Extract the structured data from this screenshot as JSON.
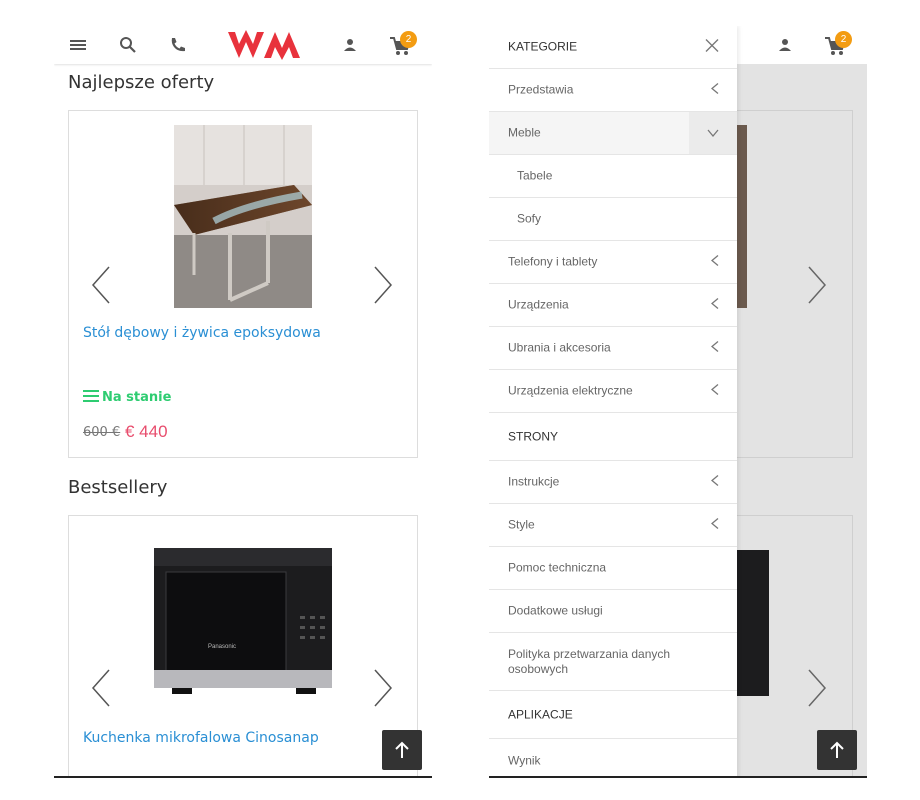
{
  "left": {
    "header": {
      "logo_text": "WM",
      "cart_count": "2"
    },
    "sections": [
      {
        "title": "Najlepsze oferty",
        "product": {
          "name": "Stół dębowy i żywica epoksydowa",
          "stock": "Na stanie",
          "price_old": "600 €",
          "price_new": "€ 440"
        }
      },
      {
        "title": "Bestsellery",
        "product": {
          "name": "Kuchenka mikrofalowa Cinosanap"
        }
      }
    ],
    "microwave_brand": "Panasonic"
  },
  "right": {
    "header": {
      "cart_count": "2"
    },
    "drawer": {
      "rows": [
        {
          "label": "KATEGORIE",
          "kind": "head",
          "icon": "close-icon"
        },
        {
          "label": "Przedstawia",
          "kind": "item",
          "icon": "chevron-left-icon"
        },
        {
          "label": "Meble",
          "kind": "active",
          "icon": "chevron-down-icon"
        },
        {
          "label": "Tabele",
          "kind": "sub"
        },
        {
          "label": "Sofy",
          "kind": "sub"
        },
        {
          "label": "Telefony i tablety",
          "kind": "item",
          "icon": "chevron-left-icon"
        },
        {
          "label": "Urządzenia",
          "kind": "item",
          "icon": "chevron-left-icon"
        },
        {
          "label": "Ubrania i akcesoria",
          "kind": "item",
          "icon": "chevron-left-icon"
        },
        {
          "label": "Urządzenia elektryczne",
          "kind": "item",
          "icon": "chevron-left-icon"
        },
        {
          "label": "STRONY",
          "kind": "head"
        },
        {
          "label": "Instrukcje",
          "kind": "item",
          "icon": "chevron-left-icon"
        },
        {
          "label": "Style",
          "kind": "item",
          "icon": "chevron-left-icon"
        },
        {
          "label": "Pomoc techniczna",
          "kind": "item"
        },
        {
          "label": "Dodatkowe usługi",
          "kind": "item"
        },
        {
          "label": "Polityka przetwarzania danych osobowych",
          "kind": "item"
        },
        {
          "label": "APLIKACJE",
          "kind": "head"
        },
        {
          "label": "Wynik",
          "kind": "item"
        }
      ]
    }
  },
  "colors": {
    "accent_logo": "#e8323c",
    "link": "#2a8fd4",
    "price": "#e84d6d",
    "stock": "#2ecc71",
    "badge": "#f39c12"
  }
}
